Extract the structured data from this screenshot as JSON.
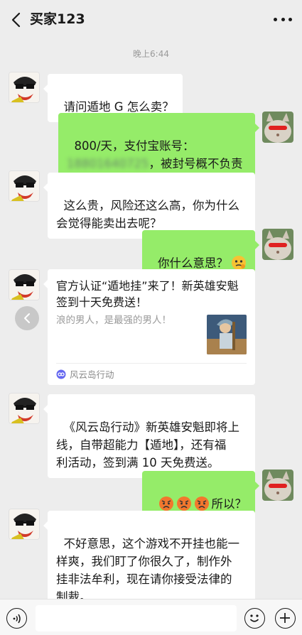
{
  "header": {
    "title": "买家123"
  },
  "timestamp": "晚上6:44",
  "messages": {
    "m1": {
      "text": "请问遁地 G 怎么卖？"
    },
    "m2": {
      "line1": "800/天，支付宝账号：",
      "redacted": "18801640725",
      "line2_suffix": "，被封号概不负责"
    },
    "m3": {
      "text": "这么贵，风险还这么高，你为什么\n会觉得能卖出去呢？"
    },
    "m4": {
      "text": "你什么意思？"
    },
    "m5_card": {
      "title": "官方认证“遁地挂”来了！新英雄安魁签到十天免费送！",
      "desc": "浪的男人，是最强的男人！",
      "source": "风云岛行动"
    },
    "m6": {
      "text": "《风云岛行动》新英雄安魁即将上\n线，自带超能力【遁地】，还有福\n利活动，签到满 10 天免费送。"
    },
    "m7": {
      "text": "所以？"
    },
    "m8": {
      "text": "不好意思，这个游戏不开挂也能一\n样爽，我们盯了你很久了，制作外\n挂非法牟利，现在请你接受法律的\n制裁。"
    }
  },
  "icons": [
    "back-icon",
    "more-icon",
    "forward-icon",
    "voice-icon",
    "emoji-icon",
    "plus-icon",
    "mini-program-icon"
  ],
  "colors": {
    "background": "#ededed",
    "bubble_self": "#95ec69",
    "bubble_other": "#ffffff"
  }
}
